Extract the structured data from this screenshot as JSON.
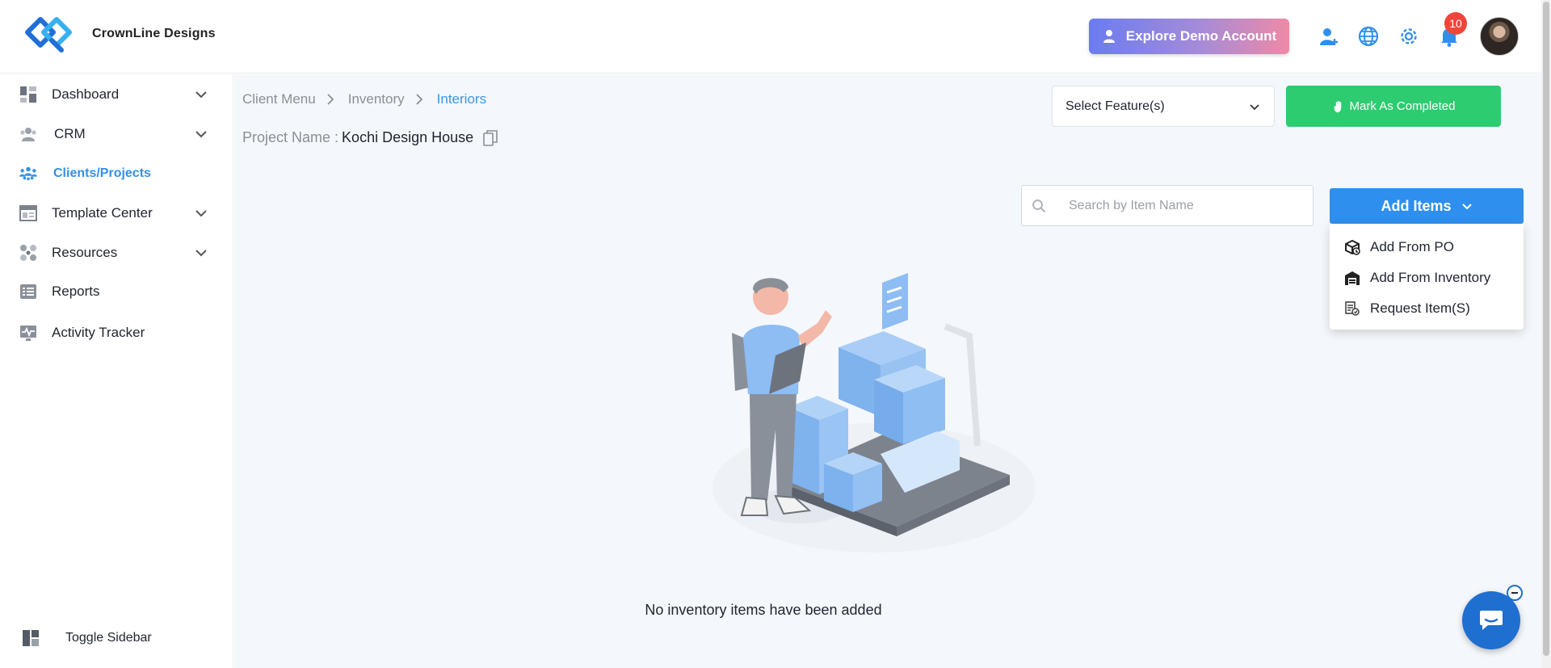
{
  "brand": {
    "name": "CrownLine Designs",
    "color": "#2f8fee"
  },
  "header": {
    "demo_label": "Explore Demo Account",
    "notification_count": "10",
    "icons": [
      "add-user-icon",
      "globe-icon",
      "gear-icon",
      "bell-icon"
    ]
  },
  "sidebar": {
    "items": [
      {
        "label": "Dashboard",
        "icon": "dashboard-icon",
        "expandable": true
      },
      {
        "label": "CRM",
        "icon": "crm-icon",
        "expandable": true
      },
      {
        "label": "Clients/Projects",
        "icon": "clients-icon",
        "expandable": false,
        "active": true
      },
      {
        "label": "Template Center",
        "icon": "template-icon",
        "expandable": true
      },
      {
        "label": "Resources",
        "icon": "resources-icon",
        "expandable": true
      },
      {
        "label": "Reports",
        "icon": "reports-icon",
        "expandable": false
      },
      {
        "label": "Activity Tracker",
        "icon": "activity-icon",
        "expandable": false
      }
    ],
    "toggle_label": "Toggle Sidebar"
  },
  "main": {
    "breadcrumb": [
      "Client Menu",
      "Inventory",
      "Interiors"
    ],
    "project_label": "Project Name :",
    "project_name": "Kochi Design House",
    "select_feature": "Select Feature(s)",
    "mark_completed": "Mark As Completed",
    "search_placeholder": "Search by Item Name",
    "add_items": "Add Items",
    "dropdown": [
      {
        "label": "Add From PO",
        "icon": "po-box-icon"
      },
      {
        "label": "Add From Inventory",
        "icon": "warehouse-icon"
      },
      {
        "label": "Request Item(S)",
        "icon": "request-icon"
      }
    ],
    "empty_message": "No inventory items have been added"
  },
  "colors": {
    "accent": "#2f8fee",
    "success": "#2ecc71",
    "badge": "#f0453a",
    "active_nav": "#3390e8"
  }
}
